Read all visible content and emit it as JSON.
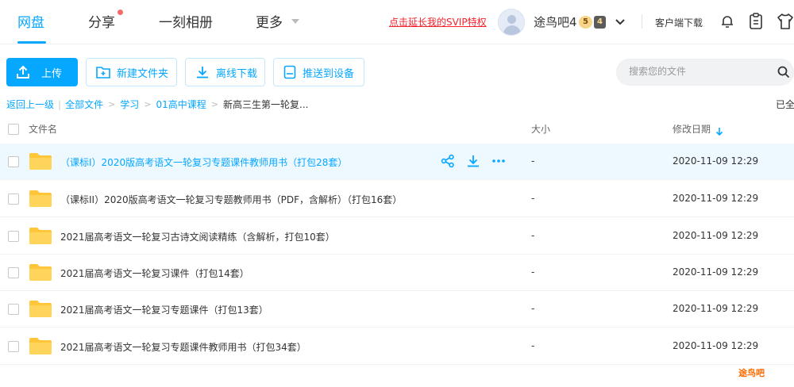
{
  "nav": {
    "tabs": [
      {
        "label": "网盘"
      },
      {
        "label": "分享"
      },
      {
        "label": "一刻相册"
      },
      {
        "label": "更多"
      }
    ],
    "svip_link": "点击延长我的SVIP特权",
    "username": "途鸟吧4",
    "level_badge": "5",
    "level_badge2": "4",
    "client_download": "客户端下载"
  },
  "toolbar": {
    "upload": "上传",
    "new_folder": "新建文件夹",
    "offline_download": "离线下载",
    "push_device": "推送到设备",
    "search_placeholder": "搜索您的文件"
  },
  "breadcrumb": {
    "back": "返回上一级",
    "items": [
      "全部文件",
      "学习",
      "01高中课程"
    ],
    "current": "新高三生第一轮复...",
    "loaded": "已全"
  },
  "table": {
    "col_name": "文件名",
    "col_size": "大小",
    "col_date": "修改日期",
    "rows": [
      {
        "name": "（课标I）2020版高考语文一轮复习专题课件教师用书（打包28套）",
        "size": "-",
        "date": "2020-11-09 12:29"
      },
      {
        "name": "（课标II）2020版高考语文一轮复习专题教师用书（PDF，含解析）（打包16套）",
        "size": "-",
        "date": "2020-11-09 12:29"
      },
      {
        "name": "2021届高考语文一轮复习古诗文阅读精练（含解析，打包10套）",
        "size": "-",
        "date": "2020-11-09 12:29"
      },
      {
        "name": "2021届高考语文一轮复习课件（打包14套）",
        "size": "-",
        "date": "2020-11-09 12:29"
      },
      {
        "name": "2021届高考语文一轮复习专题课件（打包13套）",
        "size": "-",
        "date": "2020-11-09 12:29"
      },
      {
        "name": "2021届高考语文一轮复习专题课件教师用书（打包34套）",
        "size": "-",
        "date": "2020-11-09 12:29"
      }
    ]
  },
  "watermark": "途鸟吧",
  "colors": {
    "accent": "#06a7ff",
    "folder": "#ffc63a",
    "svip": "#f5222d"
  }
}
